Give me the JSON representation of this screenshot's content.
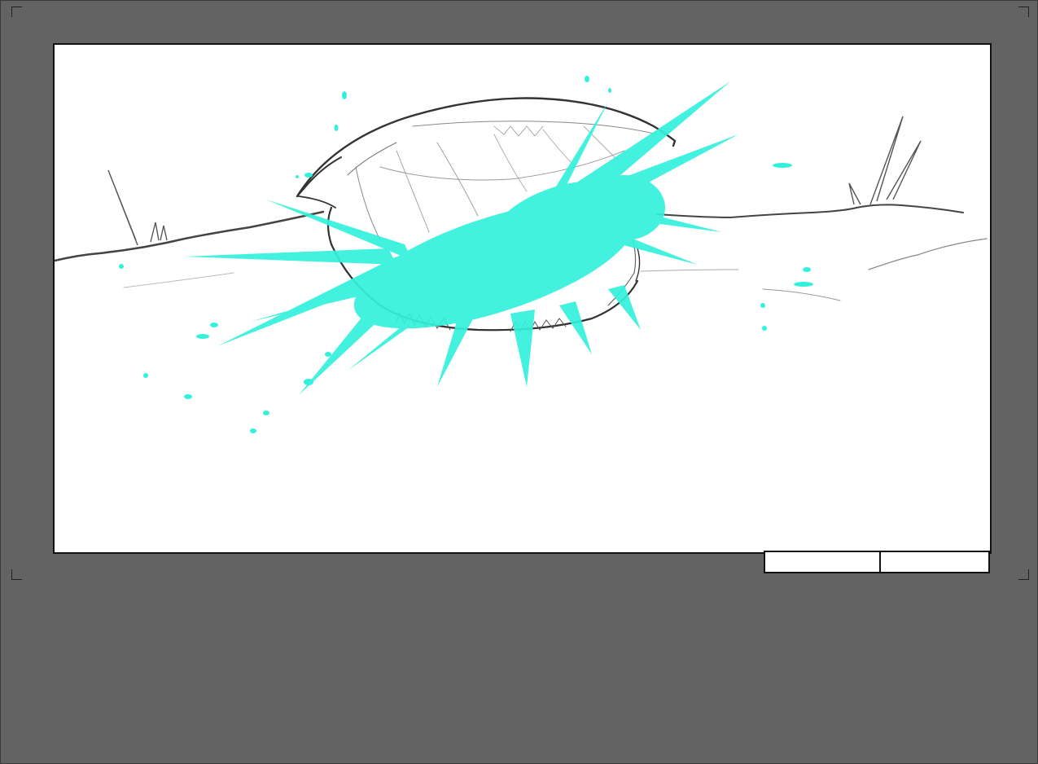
{
  "sheet": {
    "background_color": "#636363",
    "panel_border_color": "#111111",
    "sketch_line_color": "#3a3a3a",
    "effect_color": "#33f0dc"
  },
  "panel": {
    "scene_label": "",
    "shot_label": ""
  },
  "icons": {
    "crop_marks": "crop-corner-icon",
    "artwork": "clam-shell-splash-sketch"
  }
}
